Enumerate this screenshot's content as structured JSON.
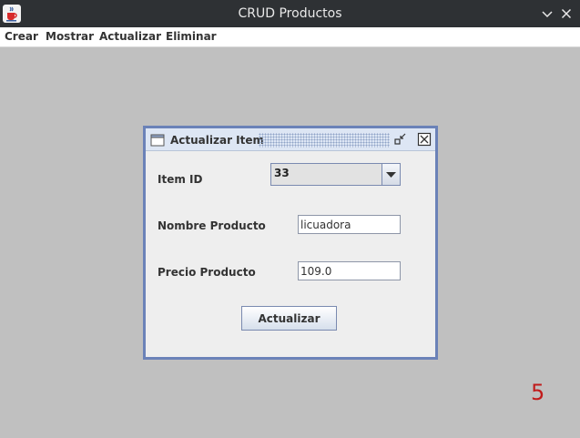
{
  "window": {
    "title": "CRUD Productos"
  },
  "menubar": {
    "items": [
      "Crear",
      "Mostrar",
      "Actualizar",
      "Eliminar"
    ]
  },
  "internal_frame": {
    "title": "Actualizar Item",
    "form": {
      "item_id_label": "Item ID",
      "item_id_value": "33",
      "nombre_label": "Nombre Producto",
      "nombre_value": "licuadora",
      "precio_label": "Precio Producto",
      "precio_value": "109.0",
      "submit_label": "Actualizar"
    }
  },
  "overlay": {
    "number": "5"
  },
  "colors": {
    "titlebar": "#2e3134",
    "desktop": "#c0c0c0",
    "frame_border": "#6b82b8",
    "overlay_number": "#c11b1b"
  },
  "icons": {
    "app": "java-cup-icon",
    "minimize": "chevron-down-icon",
    "close": "close-icon",
    "frame": "window-icon",
    "iconify": "iconify-icon",
    "frame_close": "close-box-icon",
    "combo_arrow": "triangle-down-icon"
  }
}
